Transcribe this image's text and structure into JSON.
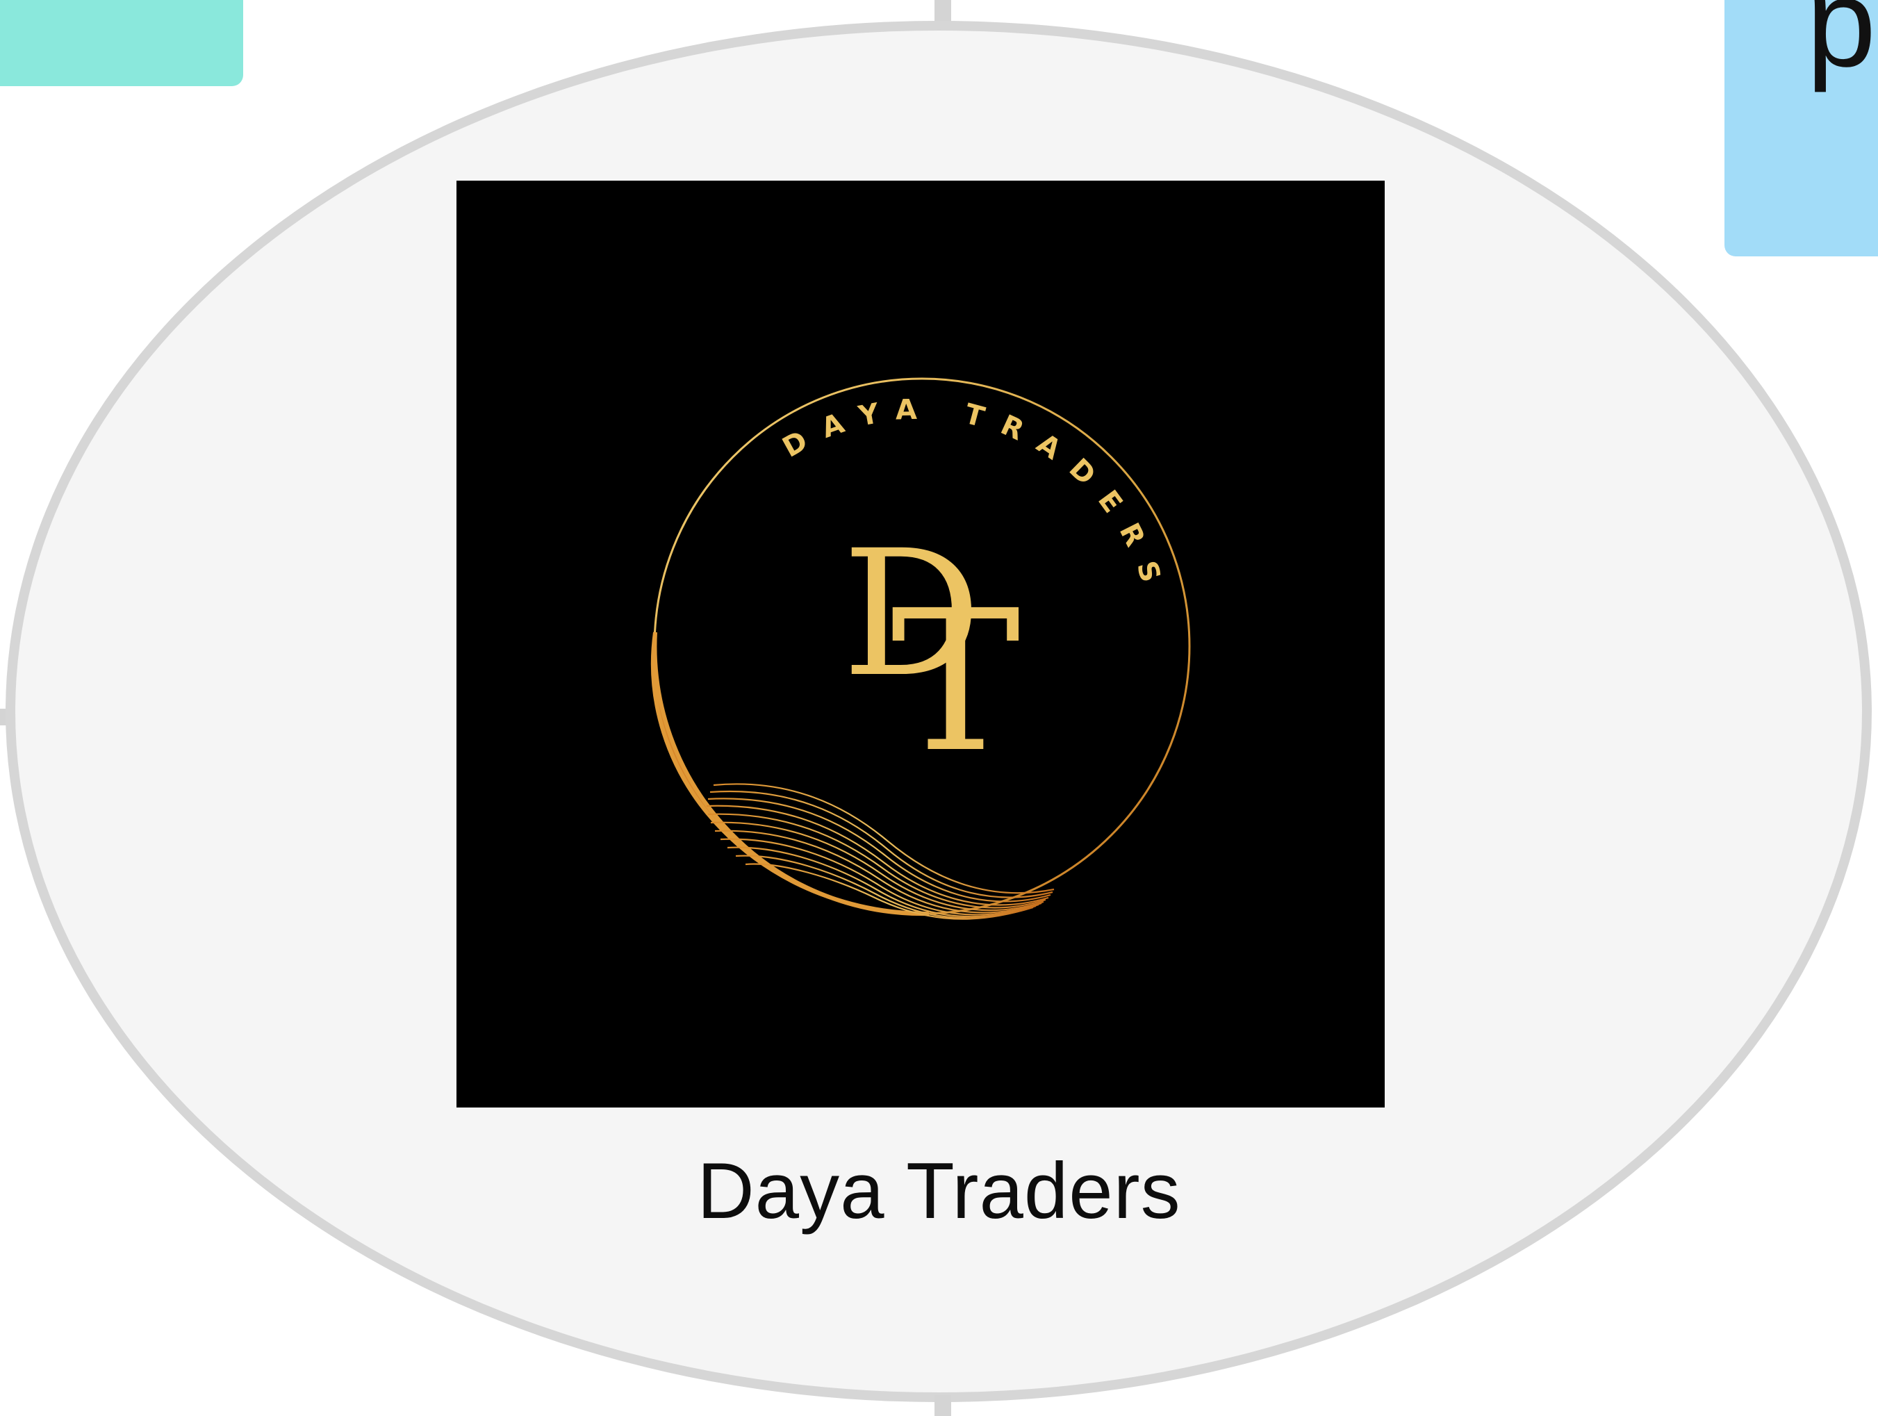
{
  "diagram": {
    "node_label": "Daya Traders",
    "partial_node_text": "p",
    "colors": {
      "ellipse_fill": "#f5f5f5",
      "ellipse_border": "#d6d6d6",
      "teal_node": "#8ae8dc",
      "blue_node": "#a2dcf8",
      "logo_background": "#000000",
      "logo_gold": "#e8c266",
      "logo_orange": "#d4892c"
    },
    "logo": {
      "ring_text": "DAYA TRADERS",
      "monogram": "DT"
    }
  }
}
